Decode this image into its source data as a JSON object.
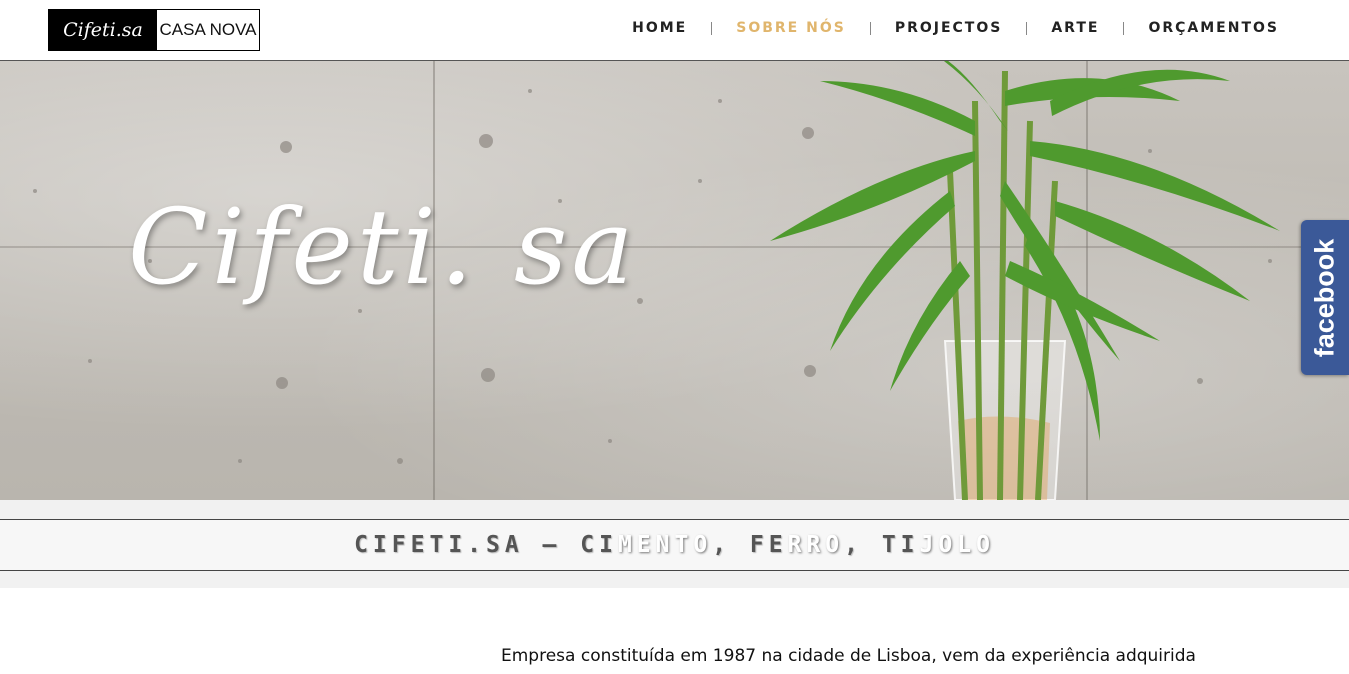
{
  "header": {
    "logo": {
      "script_text": "Cifeti.sa",
      "box_text": "CASA NOVA"
    },
    "nav": [
      {
        "label": "HOME",
        "active": false
      },
      {
        "label": "SOBRE NÓS",
        "active": true
      },
      {
        "label": "PROJECTOS",
        "active": false
      },
      {
        "label": "ARTE",
        "active": false
      },
      {
        "label": "ORÇAMENTOS",
        "active": false
      }
    ]
  },
  "hero": {
    "title": "Cifeti. sa"
  },
  "social": {
    "facebook_label": "facebook"
  },
  "banner": {
    "parts": [
      "CIFETI.SA – CI",
      "MENTO",
      ", FE",
      "RRO",
      ", TI",
      "JOLO"
    ]
  },
  "intro": {
    "text": "Empresa constituída em 1987 na cidade de Lisboa, vem da experiência adquirida"
  },
  "colors": {
    "accent": "#e0b56c",
    "facebook": "#3b5998",
    "nav_text": "#222222"
  }
}
